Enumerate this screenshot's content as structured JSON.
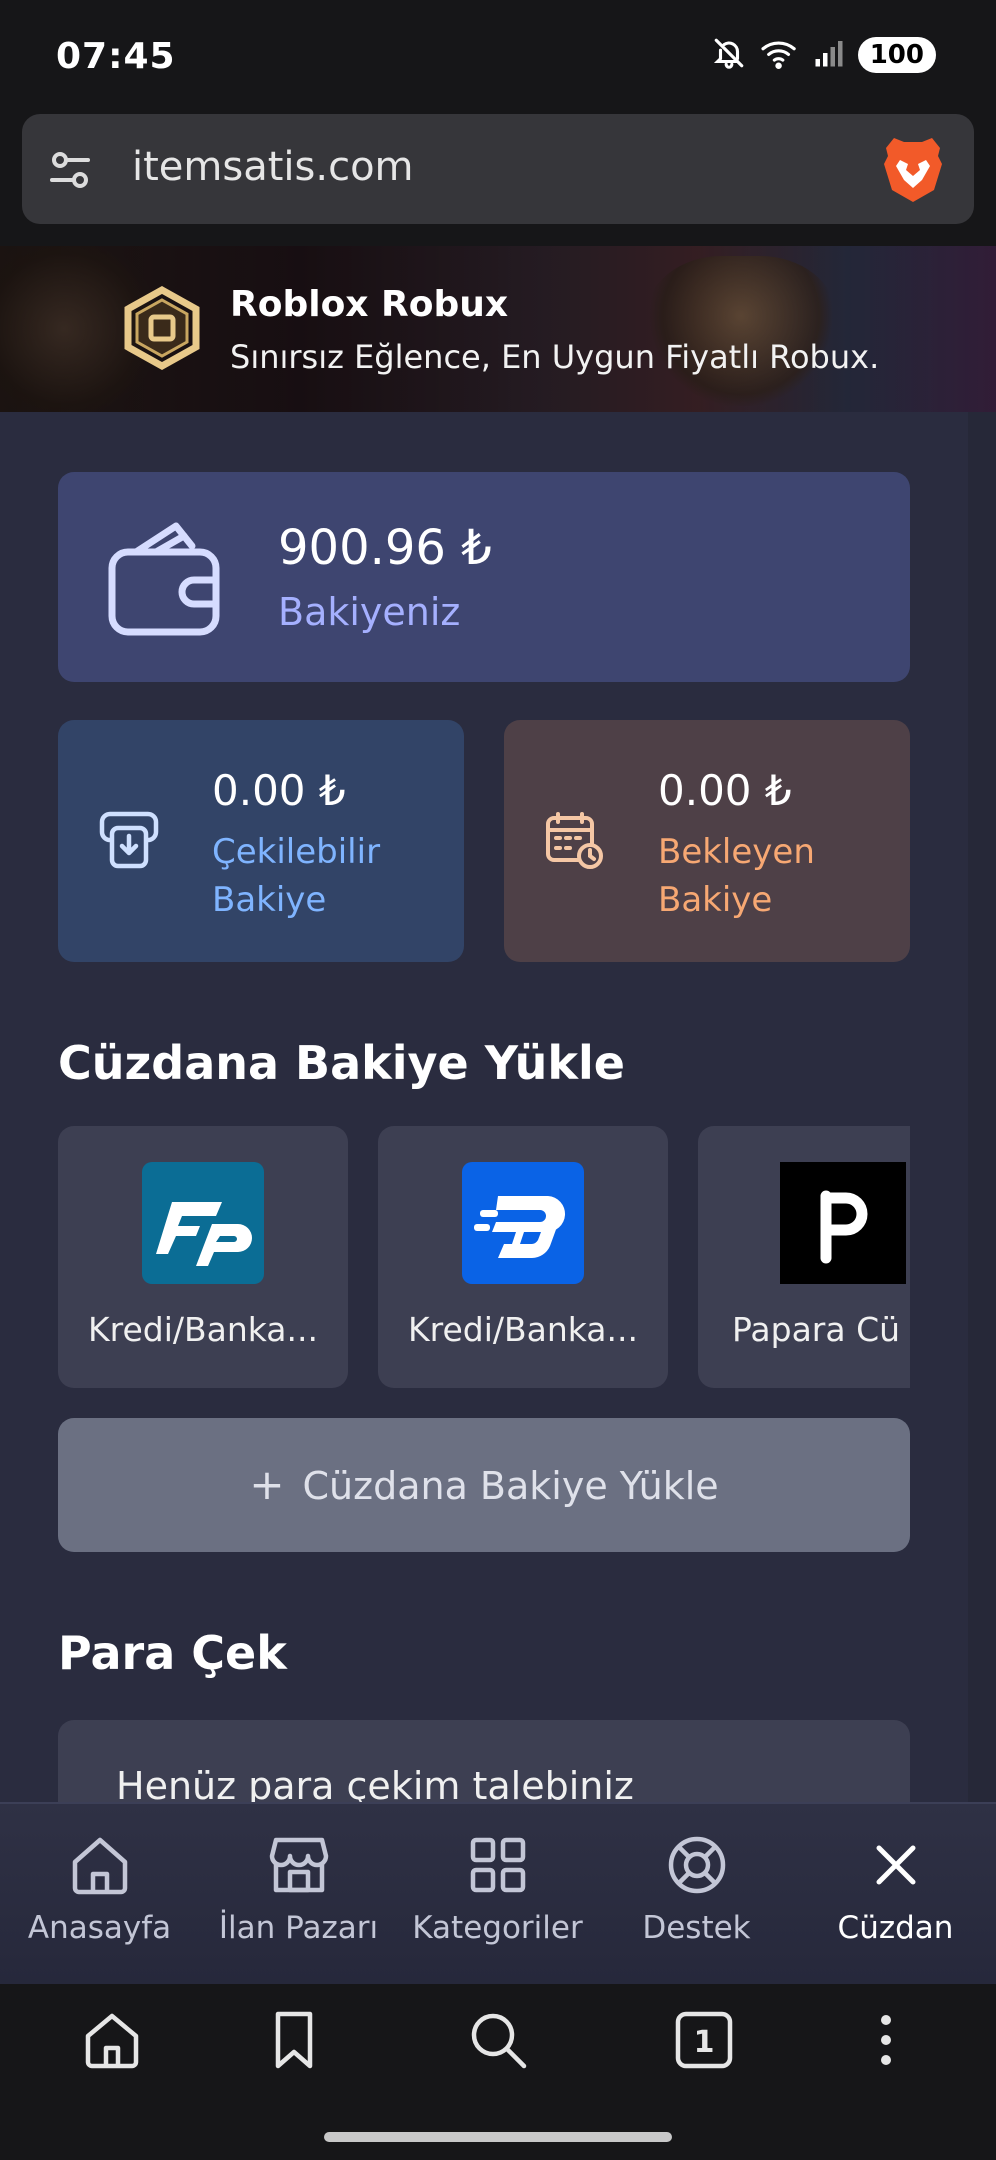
{
  "status_bar": {
    "time": "07:45",
    "battery": "100",
    "icons": [
      "mute-icon",
      "wifi-icon",
      "signal-icon"
    ]
  },
  "browser": {
    "url": "itemsatis.com",
    "tab_count": "1"
  },
  "hero": {
    "title": "Roblox Robux",
    "subtitle": "Sınırsız Eğlence, En Uygun Fiyatlı Robux."
  },
  "balance": {
    "amount": "900.96 ₺",
    "label": "Bakiyeniz"
  },
  "withdrawable": {
    "amount": "0.00 ₺",
    "label": "Çekilebilir Bakiye"
  },
  "pending": {
    "amount": "0.00 ₺",
    "label": "Bekleyen Bakiye"
  },
  "load_section": {
    "title": "Cüzdana Bakiye Yükle",
    "methods": [
      {
        "label": "Kredi/Banka...",
        "brand_color": "#0b6d95"
      },
      {
        "label": "Kredi/Banka...",
        "brand_color": "#0a63e6"
      },
      {
        "label": "Papara Cü",
        "brand_color": "#000000"
      }
    ],
    "button_label": "Cüzdana Bakiye Yükle",
    "button_icon": "+"
  },
  "withdraw_section": {
    "title": "Para Çek",
    "empty_text": "Henüz para çekim talebiniz"
  },
  "site_nav": [
    {
      "label": "Anasayfa",
      "icon": "home-icon"
    },
    {
      "label": "İlan Pazarı",
      "icon": "store-icon"
    },
    {
      "label": "Kategoriler",
      "icon": "grid-icon"
    },
    {
      "label": "Destek",
      "icon": "lifebuoy-icon"
    },
    {
      "label": "Cüzdan",
      "icon": "close-icon",
      "active": true
    }
  ],
  "colors": {
    "balance_accent": "#a5b0ff",
    "withdrawable_accent": "#7fb4ff",
    "pending_accent": "#f7a873"
  }
}
